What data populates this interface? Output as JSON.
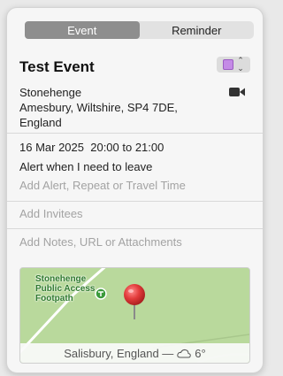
{
  "tabs": [
    {
      "label": "Event",
      "active": true
    },
    {
      "label": "Reminder",
      "active": false
    }
  ],
  "event": {
    "title": "Test Event",
    "calendar_color": "#c48be6",
    "location_lines": [
      "Stonehenge",
      "Amesbury, Wiltshire, SP4 7DE,",
      "England"
    ],
    "date": "16 Mar 2025",
    "time": "20:00 to 21:00",
    "alert": "Alert when I need to leave",
    "add_alert_placeholder": "Add Alert, Repeat or Travel Time",
    "add_invitees_placeholder": "Add Invitees",
    "add_notes_placeholder": "Add Notes, URL or Attachments"
  },
  "map": {
    "poi_label_lines": [
      "Stonehenge",
      "Public Access",
      "Footpath"
    ],
    "weather_text": "Salisbury, England —",
    "temperature": "6°",
    "pin_color": "#e23b3b"
  },
  "icons": {
    "video": "video-camera-icon",
    "weather": "cloud-icon",
    "chevron": "chevron-up-down-icon",
    "pin": "map-pin-icon",
    "poi": "footpath-poi-icon"
  }
}
